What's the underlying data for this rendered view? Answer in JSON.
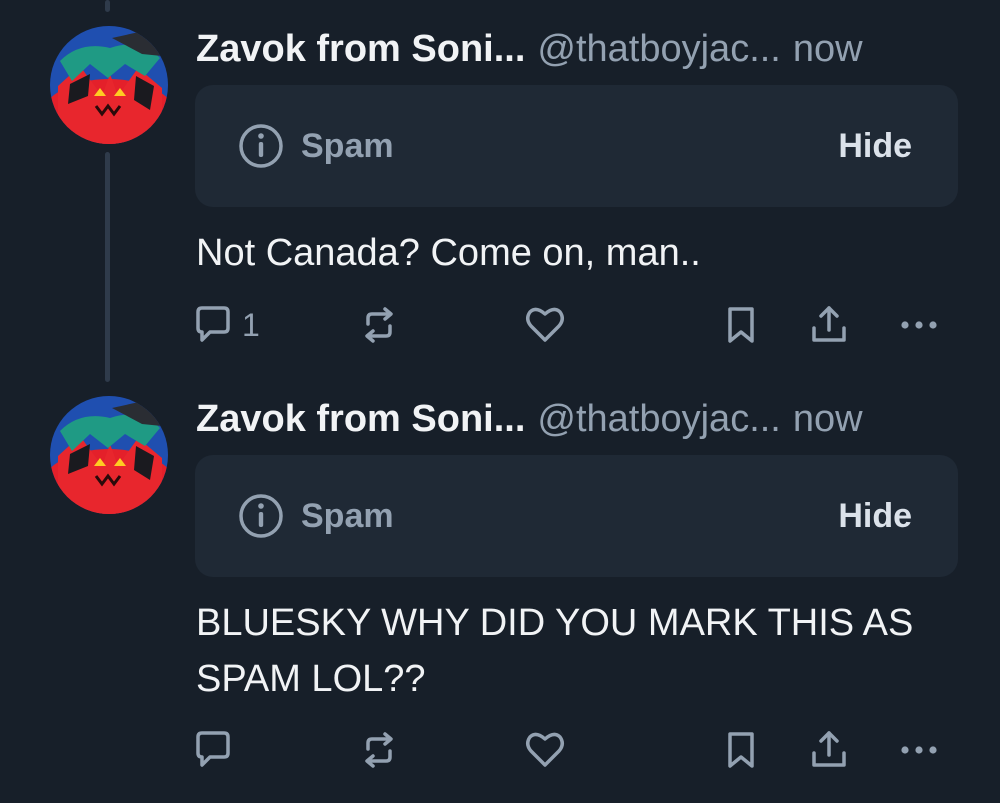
{
  "posts": [
    {
      "display_name": "Zavok from Soni...",
      "handle": "@thatboyjac...",
      "time": "now",
      "label": "Spam",
      "hide_label": "Hide",
      "text": "Not Canada? Come on, man..",
      "reply_count": "1",
      "icons": [
        "reply-icon",
        "repost-icon",
        "like-icon",
        "bookmark-icon",
        "share-icon",
        "more-icon"
      ]
    },
    {
      "display_name": "Zavok from Soni...",
      "handle": "@thatboyjac...",
      "time": "now",
      "label": "Spam",
      "hide_label": "Hide",
      "text": "BLUESKY WHY DID YOU MARK THIS AS SPAM LOL??",
      "reply_count": "",
      "icons": [
        "reply-icon",
        "repost-icon",
        "like-icon",
        "bookmark-icon",
        "share-icon",
        "more-icon"
      ]
    }
  ],
  "colors": {
    "background": "#171f29",
    "label_background": "#1f2935",
    "muted_text": "#93a1b1",
    "primary_text": "#f1f3f5"
  }
}
